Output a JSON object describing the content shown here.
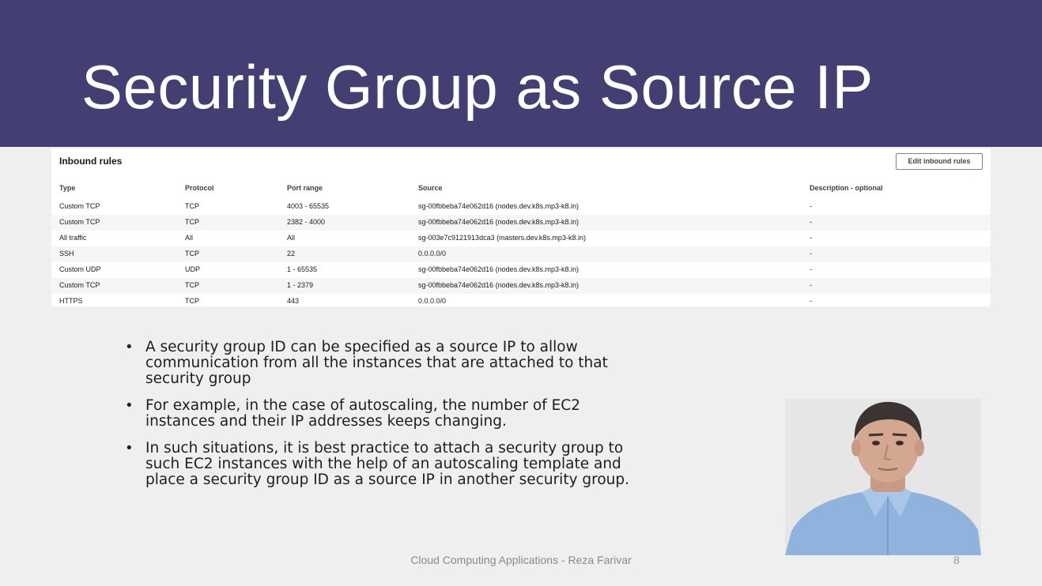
{
  "slide": {
    "title": "Security Group as Source IP",
    "footer": "Cloud Computing Applications - Reza Farivar",
    "page_number": "8"
  },
  "inbound_rules": {
    "heading": "Inbound rules",
    "edit_button": "Edit inbound rules",
    "columns": [
      "Type",
      "Protocol",
      "Port range",
      "Source",
      "Description - optional"
    ],
    "rows": [
      [
        "Custom TCP",
        "TCP",
        "4003 - 65535",
        "sg-00fbbeba74e062d16 (nodes.dev.k8s.mp3-k8.in)",
        "-"
      ],
      [
        "Custom TCP",
        "TCP",
        "2382 - 4000",
        "sg-00fbbeba74e062d16 (nodes.dev.k8s.mp3-k8.in)",
        "-"
      ],
      [
        "All traffic",
        "All",
        "All",
        "sg-003e7c9121913dca3 (masters.dev.k8s.mp3-k8.in)",
        "-"
      ],
      [
        "SSH",
        "TCP",
        "22",
        "0.0.0.0/0",
        "-"
      ],
      [
        "Custom UDP",
        "UDP",
        "1 - 65535",
        "sg-00fbbeba74e062d16 (nodes.dev.k8s.mp3-k8.in)",
        "-"
      ],
      [
        "Custom TCP",
        "TCP",
        "1 - 2379",
        "sg-00fbbeba74e062d16 (nodes.dev.k8s.mp3-k8.in)",
        "-"
      ],
      [
        "HTTPS",
        "TCP",
        "443",
        "0.0.0.0/0",
        "-"
      ]
    ]
  },
  "bullets": [
    {
      "marker": "•",
      "lines": [
        "A security group ID can be specified as a source IP to allow",
        "communication from all the instances that are attached to that",
        "security group"
      ]
    },
    {
      "marker": "•",
      "lines": [
        "For example, in the case of autoscaling, the number of EC2",
        "instances and their IP addresses keeps changing."
      ]
    },
    {
      "marker": "•",
      "lines": [
        "In such situations, it is best practice to attach a security group to",
        "such EC2 instances with the help of an autoscaling template and",
        "place a security group ID as a source IP in another security group."
      ]
    }
  ],
  "colors": {
    "header_bg": "#443f72",
    "slide_bg": "#efefef",
    "title_text": "#ffffff"
  }
}
